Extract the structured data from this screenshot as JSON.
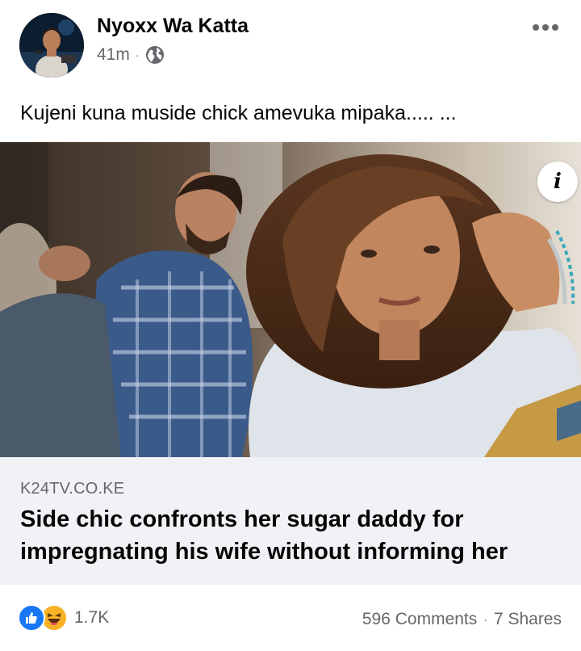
{
  "post": {
    "author": "Nyoxx Wa Katta",
    "time": "41m",
    "separator": "·",
    "privacy_icon": "globe-icon",
    "more_icon": "more-options-icon",
    "text": "Kujeni kuna muside chick amevuka mipaka..... ..."
  },
  "link_preview": {
    "domain": "K24TV.CO.KE",
    "title": "Side chic confronts her sugar daddy for impregnating his wife without informing her",
    "info_label": "i"
  },
  "engagement": {
    "reaction_icons": [
      "like-icon",
      "haha-icon"
    ],
    "reaction_count": "1.7K",
    "comments": "596 Comments",
    "separator": "·",
    "shares": "7 Shares"
  },
  "colors": {
    "like_blue": "#1877f2",
    "haha_yellow": "#f7b125",
    "secondary_text": "#65676b",
    "caption_bg": "#f0f2f5"
  }
}
